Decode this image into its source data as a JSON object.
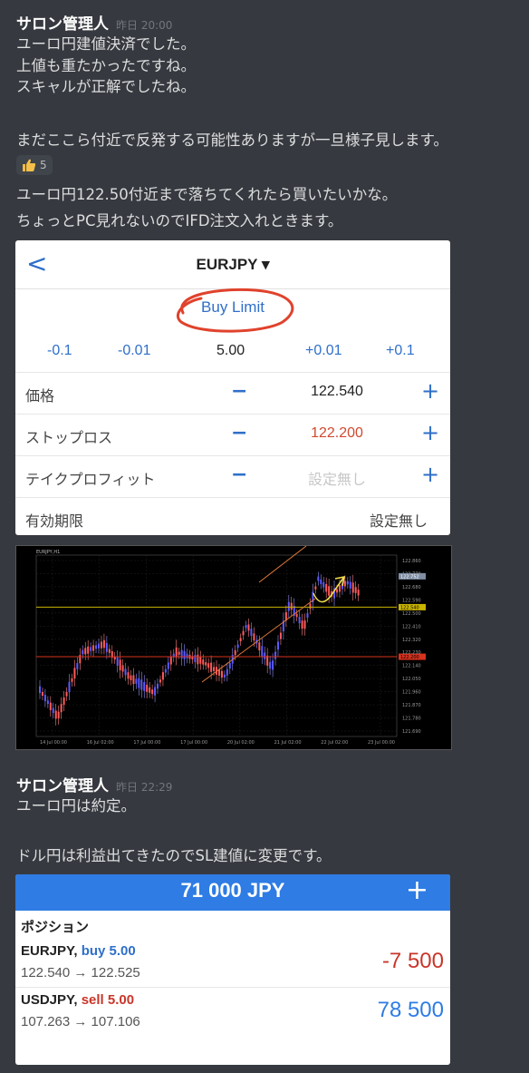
{
  "message1": {
    "author": "サロン管理人",
    "time": "昨日 20:00",
    "lines": [
      "ユーロ円建値決済でした。",
      "上値も重たかったですね。",
      "スキャルが正解でしたね。"
    ],
    "line4": "まだここら付近で反発する可能性ありますが一旦様子見します。",
    "reaction": {
      "icon": "thumbs-up-icon",
      "count": "5"
    },
    "line5": "ユーロ円122.50付近まで落ちてくれたら買いたいかな。",
    "line6": "ちょっとPC見れないのでIFD注文入れときます。"
  },
  "order": {
    "symbol": "EURJPY ▾",
    "back": "<",
    "type": "Buy Limit",
    "steps": [
      "-0.1",
      "-0.01",
      "5.00",
      "+0.01",
      "+0.1"
    ],
    "rows": [
      {
        "label": "価格",
        "value": "122.540",
        "color": "#222222"
      },
      {
        "label": "ストップロス",
        "value": "122.200",
        "color": "#d0492f"
      },
      {
        "label": "テイクプロフィット",
        "value": "設定無し",
        "color": "#c7c7c7"
      }
    ],
    "expiry": {
      "label": "有効期限",
      "value": "設定無し"
    }
  },
  "chart_data": {
    "type": "candlestick",
    "title": "EURJPY,H1",
    "y_ticks": [
      "122.860",
      "122.770",
      "122.680",
      "122.590",
      "122.500",
      "122.410",
      "122.320",
      "122.230",
      "122.140",
      "122.050",
      "121.960",
      "121.870",
      "121.780",
      "121.690"
    ],
    "x_ticks": [
      "14 Jul 00:00",
      "16 Jul 02:00",
      "17 Jul 00:00",
      "17 Jul 00:00",
      "20 Jul 02:00",
      "21 Jul 02:00",
      "22 Jul 02:00",
      "23 Jul 00:00"
    ],
    "price_markers": [
      {
        "label": "122.540",
        "color": "#c8b400"
      },
      {
        "label": "122.200",
        "color": "#d6321e"
      }
    ],
    "current_price": "122.752"
  },
  "message2": {
    "author": "サロン管理人",
    "time": "昨日 22:29",
    "line1": "ユーロ円は約定。",
    "line2": "ドル円は利益出てきたのでSL建値に変更です。"
  },
  "positions": {
    "balance": "71 000 JPY",
    "add": "+",
    "title": "ポジション",
    "items": [
      {
        "symbol": "EURJPY,",
        "dir": "buy 5.00",
        "dir_color": "#2f6fc9",
        "prices": "122.540 → 122.525",
        "pl": "-7 500",
        "pl_color": "#c9362a"
      },
      {
        "symbol": "USDJPY,",
        "dir": "sell 5.00",
        "dir_color": "#c9362a",
        "prices": "107.263 → 107.106",
        "pl": "78 500",
        "pl_color": "#2e7ce4"
      }
    ]
  }
}
